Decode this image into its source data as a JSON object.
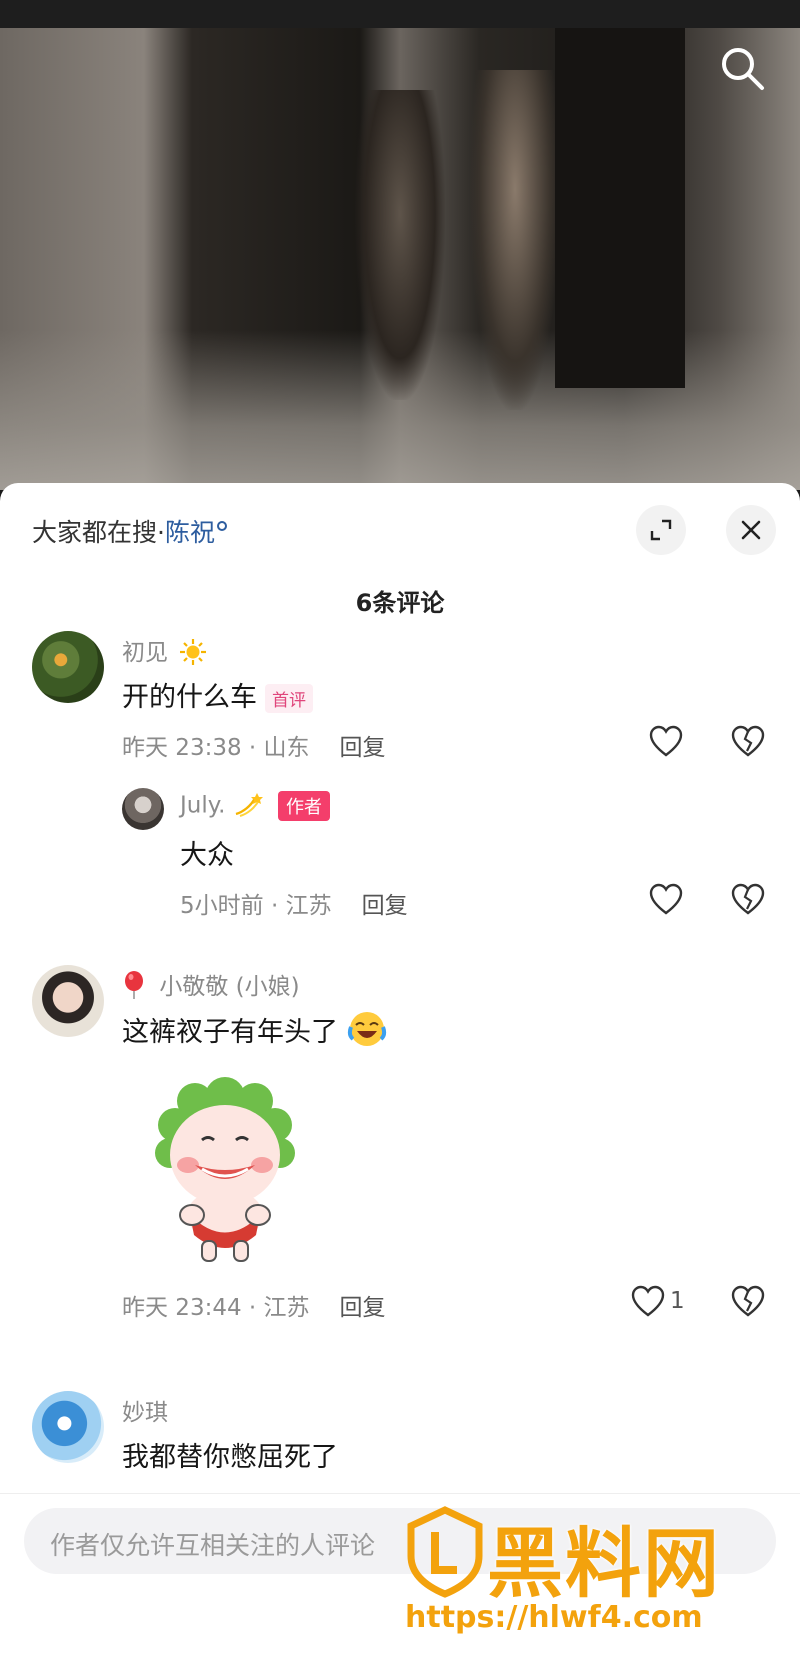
{
  "hot_search": {
    "prefix": "大家都在搜·",
    "keyword": "陈祝"
  },
  "comment_count": "6条评论",
  "comments": [
    {
      "user": "初见",
      "user_emoji": "sun-icon",
      "text": "开的什么车",
      "badge": "首评",
      "time_location": "昨天 23:38 · 山东",
      "reply_label": "回复",
      "likes": ""
    },
    {
      "user": "July.",
      "user_emoji": "dizzy-icon",
      "badge": "作者",
      "text": "大众",
      "time_location": "5小时前 · 江苏",
      "reply_label": "回复",
      "likes": ""
    },
    {
      "user": "小敬敬 (小娘)",
      "user_emoji": "balloon-icon",
      "text": "这裤衩子有年头了",
      "text_emoji": "crying-laughing-icon",
      "sticker": "clown-baby-sticker",
      "time_location": "昨天 23:44 · 江苏",
      "reply_label": "回复",
      "likes": "1"
    },
    {
      "user": "妙琪",
      "text": "我都替你憋屈死了"
    }
  ],
  "input": {
    "placeholder": "作者仅允许互相关注的人评论"
  },
  "watermark": {
    "title": "黑料网",
    "url": "https://hlwf4.com"
  },
  "colors": {
    "accent_pink": "#f43e6b",
    "keyword_blue": "#2d5d9f",
    "watermark_orange": "#f3a20d"
  }
}
